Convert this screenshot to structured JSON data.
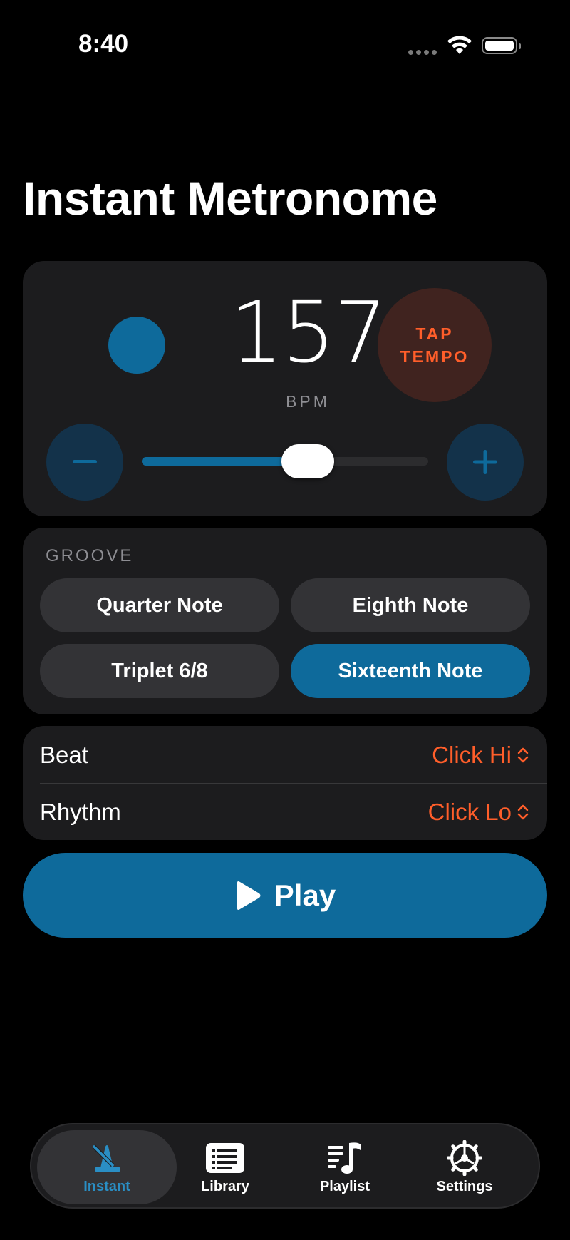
{
  "status_bar": {
    "time": "8:40"
  },
  "page": {
    "title": "Instant Metronome"
  },
  "tempo": {
    "bpm": "157",
    "bpm_label": "BPM",
    "tap_line1": "TAP",
    "tap_line2": "TEMPO",
    "minus_icon": "minus-icon",
    "plus_icon": "plus-icon",
    "slider_fraction": 0.58
  },
  "groove": {
    "title": "GROOVE",
    "options": [
      {
        "label": "Quarter Note",
        "selected": false
      },
      {
        "label": "Eighth Note",
        "selected": false
      },
      {
        "label": "Triplet 6/8",
        "selected": false
      },
      {
        "label": "Sixteenth Note",
        "selected": true
      }
    ]
  },
  "sounds": {
    "beat_label": "Beat",
    "beat_value": "Click Hi",
    "rhythm_label": "Rhythm",
    "rhythm_value": "Click Lo"
  },
  "play": {
    "label": "Play",
    "icon": "play-icon"
  },
  "tabs": [
    {
      "label": "Instant",
      "icon": "metronome-icon",
      "active": true
    },
    {
      "label": "Library",
      "icon": "list-icon",
      "active": false
    },
    {
      "label": "Playlist",
      "icon": "music-list-icon",
      "active": false
    },
    {
      "label": "Settings",
      "icon": "gear-icon",
      "active": false
    }
  ],
  "colors": {
    "accent_blue": "#0e6a9b",
    "accent_orange": "#ff5e2a",
    "card_bg": "#1c1c1e"
  }
}
